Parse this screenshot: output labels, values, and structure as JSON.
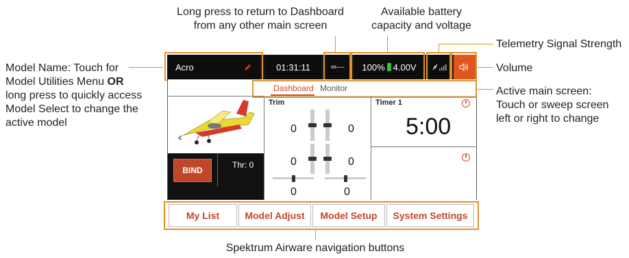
{
  "callouts": {
    "dashboard": "Long press to return to Dashboard from any other main screen",
    "dashboard_line1": "Long press to return to Dashboard",
    "dashboard_line2": "from any other main screen",
    "battery_line1": "Available battery",
    "battery_line2": "capacity and voltage",
    "telemetry": "Telemetry Signal Strength",
    "volume": "Volume",
    "model_name_line1": "Model Name: Touch for",
    "model_name_line2": "Model Utilities Menu",
    "model_name_or": "OR",
    "model_name_line3": "long press to quickly access",
    "model_name_line4": "Model Select to change the",
    "model_name_line5": "active model",
    "active_screen_line1": "Active main screen:",
    "active_screen_line2": "Touch or sweep screen",
    "active_screen_line3": "left or right to change",
    "navigation": "Spektrum Airware navigation buttons"
  },
  "status_bar": {
    "model_name": "Acro",
    "timer": "01:31:11",
    "signal": "----",
    "battery_percent": "100%",
    "voltage": "4.00V"
  },
  "tabs": [
    "Dashboard",
    "Monitor"
  ],
  "trim": {
    "label": "Trim",
    "values": [
      "0",
      "0",
      "0",
      "0",
      "0",
      "0"
    ]
  },
  "timer1": {
    "label": "Timer 1",
    "value": "5:00"
  },
  "bind": {
    "label": "BIND",
    "throttle": "Thr: 0"
  },
  "nav_buttons": [
    "My List",
    "Model Adjust",
    "Model Setup",
    "System Settings"
  ],
  "colors": {
    "accent": "#d4471f",
    "callout_line": "#e0902a",
    "battery": "#3fbf3f",
    "status_bar": "#1b1b1b"
  }
}
